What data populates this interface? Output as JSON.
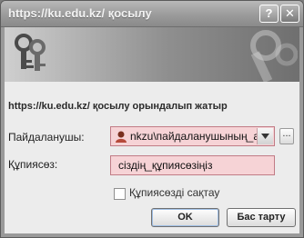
{
  "window": {
    "title": "https://ku.edu.kz/ қосылу",
    "help_glyph": "?",
    "close_glyph": "✕"
  },
  "message": "https://ku.edu.kz/ қосылу орындалып жатыр",
  "username": {
    "label": "Пайдаланушы:",
    "value": "nkzu\\пайдаланушының_аты",
    "browse_label": "..."
  },
  "password": {
    "label": "Құпиясөз:",
    "value": "сіздің_құпиясөзіңіз"
  },
  "remember": {
    "label": "Құпиясөзді сақтау",
    "checked": false
  },
  "buttons": {
    "ok": "OK",
    "cancel": "Бас тарту"
  },
  "icons": {
    "banner": "keys-icon",
    "user": "user-icon",
    "dropdown": "chevron-down-icon"
  },
  "colors": {
    "field_highlight": "#f6d3d6",
    "field_border": "#c17c86"
  }
}
